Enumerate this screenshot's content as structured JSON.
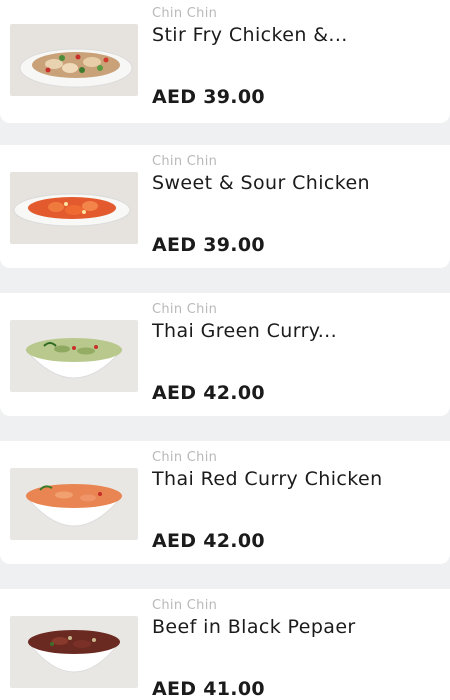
{
  "menu": {
    "items": [
      {
        "restaurant": "Chin Chin",
        "name": "Stir Fry Chicken &...",
        "price": "AED 39.00",
        "image_icon": "stir-fry-chicken-photo"
      },
      {
        "restaurant": "Chin Chin",
        "name": "Sweet & Sour Chicken",
        "price": "AED 39.00",
        "image_icon": "sweet-sour-chicken-photo"
      },
      {
        "restaurant": "Chin Chin",
        "name": "Thai Green Curry...",
        "price": "AED 42.00",
        "image_icon": "thai-green-curry-photo"
      },
      {
        "restaurant": "Chin Chin",
        "name": "Thai Red Curry Chicken",
        "price": "AED 42.00",
        "image_icon": "thai-red-curry-photo"
      },
      {
        "restaurant": "Chin Chin",
        "name": "Beef in Black Pepaer",
        "price": "AED 41.00",
        "image_icon": "beef-black-pepper-photo"
      }
    ]
  },
  "colors": {
    "background": "#eef0f1",
    "card": "#ffffff",
    "restaurant_text": "#b9b9b9",
    "title_text": "#1b1b1b"
  }
}
